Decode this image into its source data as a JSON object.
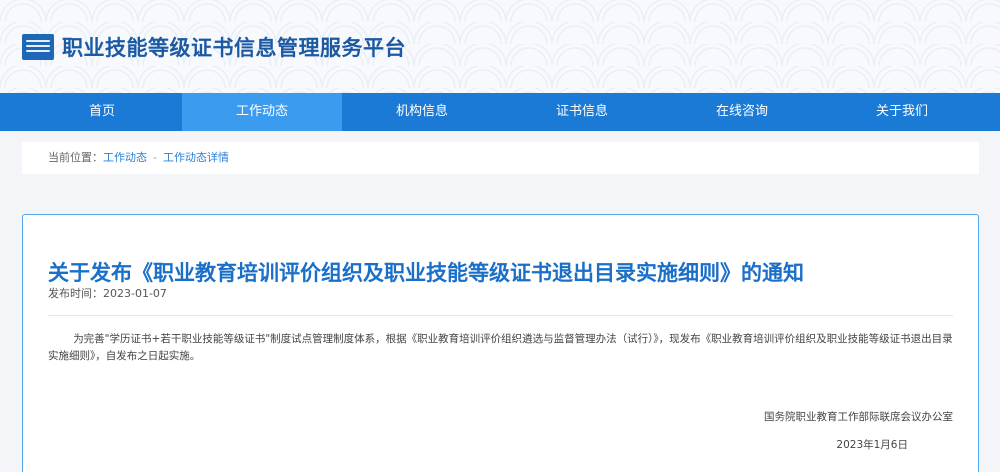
{
  "header": {
    "site_title": "职业技能等级证书信息管理服务平台",
    "logo_icon": "book-logo-icon",
    "brand_color": "#1b5aa3"
  },
  "nav": {
    "items": [
      {
        "label": "首页"
      },
      {
        "label": "工作动态"
      },
      {
        "label": "机构信息"
      },
      {
        "label": "证书信息"
      },
      {
        "label": "在线咨询"
      },
      {
        "label": "关于我们"
      }
    ],
    "active_label": "工作动态",
    "bar_color": "#1a7ad6",
    "active_color": "#3b9cef"
  },
  "breadcrumb": {
    "prefix": "当前位置：",
    "items": [
      "工作动态",
      "工作动态详情"
    ],
    "separator": "-"
  },
  "article": {
    "title": "关于发布《职业教育培训评价组织及职业技能等级证书退出目录实施细则》的通知",
    "date_label": "发布时间：",
    "date": "2023-01-07",
    "body": "为完善\"学历证书+若干职业技能等级证书\"制度试点管理制度体系，根据《职业教育培训评价组织遴选与监督管理办法（试行）》，现发布《职业教育培训评价组织及职业技能等级证书退出目录实施细则》，自发布之日起实施。",
    "signature": "国务院职业教育工作部际联席会议办公室",
    "sign_date": "2023年1月6日",
    "title_color": "#1a6fc8"
  }
}
